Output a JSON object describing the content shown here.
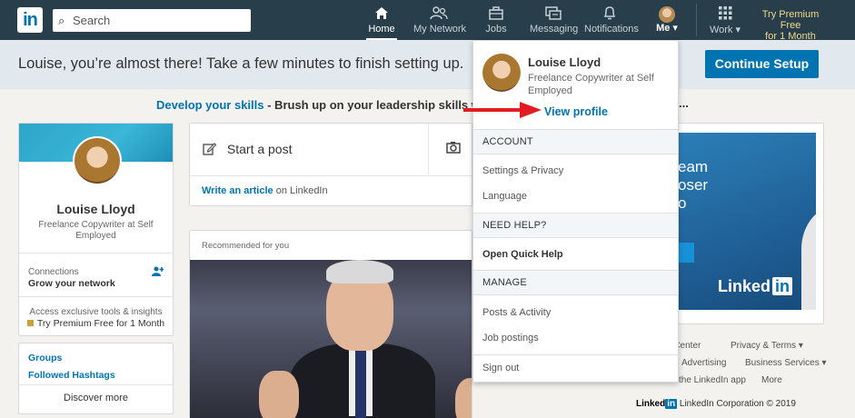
{
  "nav": {
    "logo": "in",
    "search_placeholder": "Search",
    "items": [
      {
        "label": "Home",
        "icon": "home-icon"
      },
      {
        "label": "My Network",
        "icon": "network-icon"
      },
      {
        "label": "Jobs",
        "icon": "briefcase-icon"
      },
      {
        "label": "Messaging",
        "icon": "messaging-icon"
      },
      {
        "label": "Notifications",
        "icon": "bell-icon"
      },
      {
        "label": "Me ▾",
        "icon": "avatar"
      },
      {
        "label": "Work ▾",
        "icon": "grid-icon"
      }
    ],
    "premium_line1": "Try Premium Free",
    "premium_line2": "for 1 Month"
  },
  "banner": {
    "text": "Louise, you’re almost there! Take a few minutes to finish setting up.",
    "cta": "Continue Setup"
  },
  "skills": {
    "link": "Develop your skills",
    "text": " - Brush up on your leadership skills with u",
    "trail": "..."
  },
  "profile": {
    "name": "Louise Lloyd",
    "headline": "Freelance Copywriter at Self Employed",
    "connections_label": "Connections",
    "grow": "Grow your network",
    "access": "Access exclusive tools & insights",
    "try_premium": "Try Premium Free for 1 Month"
  },
  "groups": {
    "groups": "Groups",
    "hashtags": "Followed Hashtags",
    "discover": "Discover more"
  },
  "composer": {
    "start_post": "Start a post",
    "write_article": "Write an article",
    "on_linkedin": " on LinkedIn"
  },
  "feed": {
    "recommended": "Recommended for you"
  },
  "ad": {
    "line1": "eam",
    "line2": "oser",
    "line3": "o",
    "brand": "Linked",
    "brand_in": "in"
  },
  "footer": {
    "help": "p Center",
    "privacy": "Privacy & Terms ▾",
    "advertising": "Advertising",
    "business": "Business Services ▾",
    "app": "the LinkedIn app",
    "more": "More",
    "logo": "Linked",
    "logo_in": "in",
    "copyright": " LinkedIn Corporation © 2019"
  },
  "menu": {
    "name": "Louise Lloyd",
    "headline": "Freelance Copywriter at Self Employed",
    "view_profile": "View profile",
    "account": "ACCOUNT",
    "settings": "Settings & Privacy",
    "language": "Language",
    "need_help": "NEED HELP?",
    "quick_help": "Open Quick Help",
    "manage": "MANAGE",
    "posts": "Posts & Activity",
    "jobs": "Job postings",
    "signout": "Sign out"
  },
  "colors": {
    "nav_bg": "#283e4a",
    "brand_blue": "#0073b1",
    "arrow": "#e31b23"
  }
}
